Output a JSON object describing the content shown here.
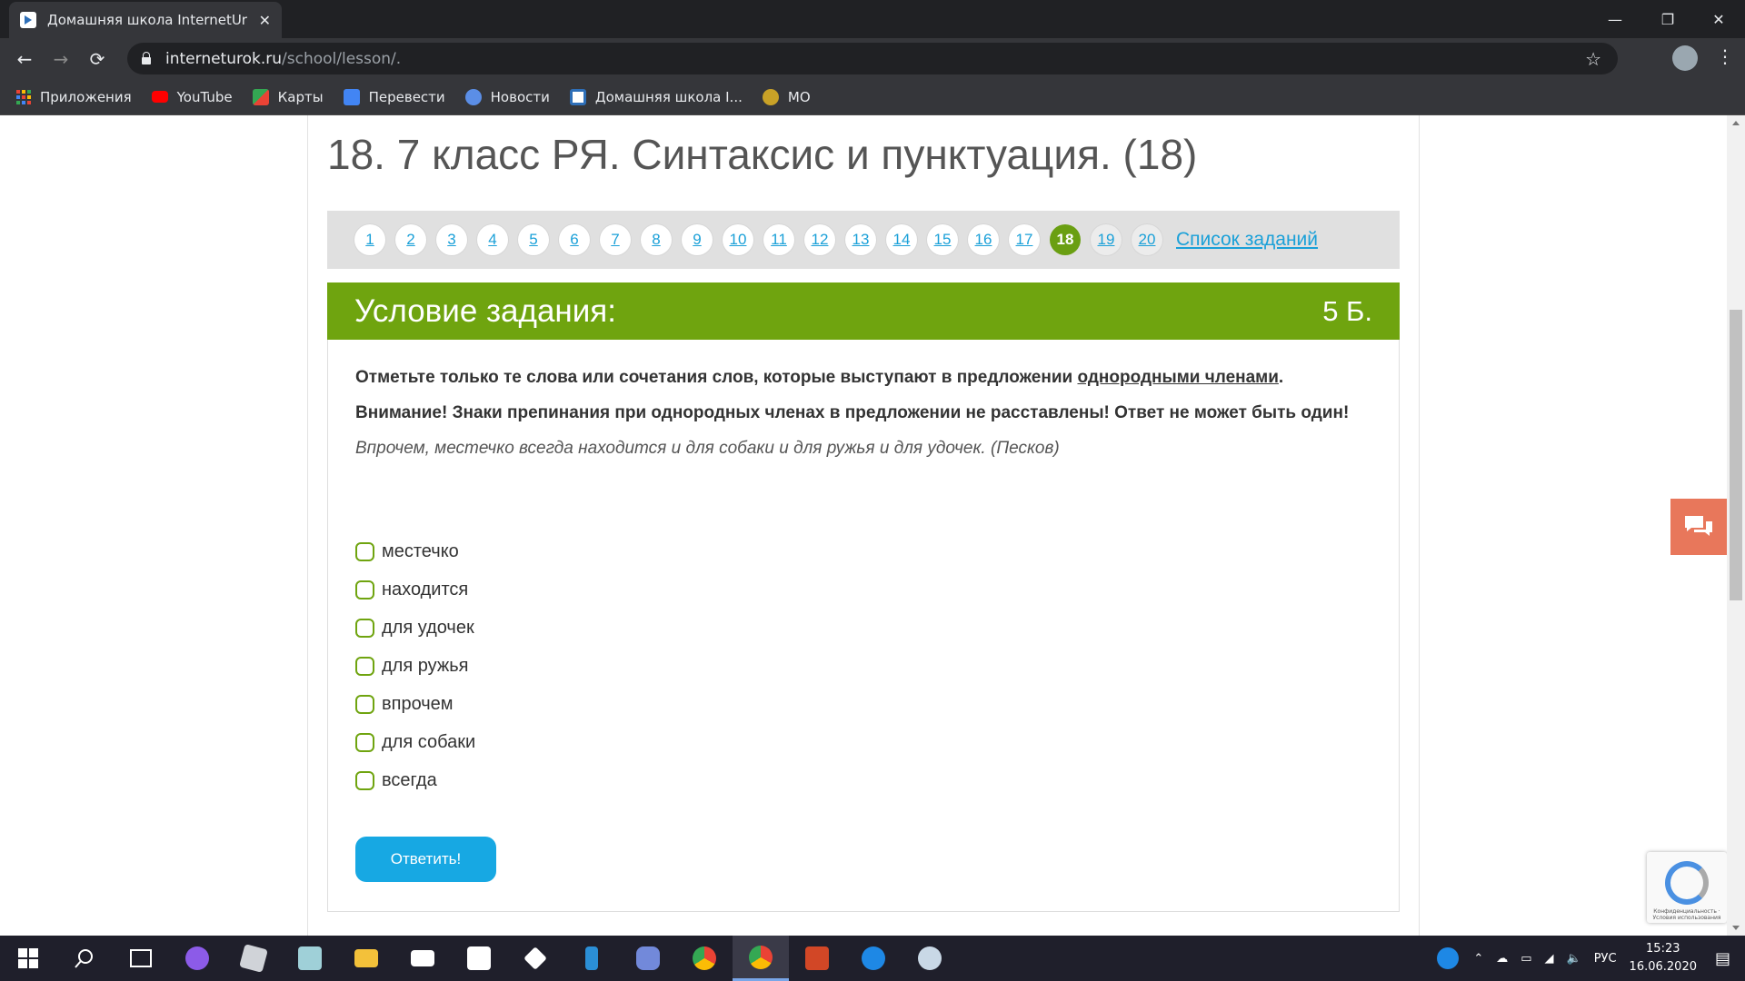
{
  "browser": {
    "tab_title": "Домашняя школа InternetUrok.r",
    "tab_close": "✕",
    "url_host": "interneturok.ru",
    "url_path": "/school/lesson/.",
    "controls": {
      "minimize": "—",
      "maximize": "❐",
      "close": "✕"
    },
    "nav": {
      "back": "←",
      "forward": "→",
      "reload": "⟳"
    },
    "star": "☆",
    "menu": "⋮"
  },
  "bookmarks": [
    {
      "label": "Приложения",
      "icon": "apps-icon"
    },
    {
      "label": "YouTube",
      "icon": "youtube-icon",
      "color": "#ff0000"
    },
    {
      "label": "Карты",
      "icon": "maps-icon",
      "color": "#34a853"
    },
    {
      "label": "Перевести",
      "icon": "translate-icon",
      "color": "#4285f4"
    },
    {
      "label": "Новости",
      "icon": "news-icon",
      "color": "#5b8ee6"
    },
    {
      "label": "Домашняя школа I...",
      "icon": "interneturok-icon",
      "color": "#2e6fb8"
    },
    {
      "label": "МО",
      "icon": "mo-icon",
      "color": "#c9a227"
    }
  ],
  "lesson": {
    "title": "18. 7 класс РЯ. Синтаксис и пунктуация. (18)"
  },
  "pager": {
    "pages": [
      "1",
      "2",
      "3",
      "4",
      "5",
      "6",
      "7",
      "8",
      "9",
      "10",
      "11",
      "12",
      "13",
      "14",
      "15",
      "16",
      "17",
      "18",
      "19",
      "20"
    ],
    "active": "18",
    "list_link": "Список заданий"
  },
  "task": {
    "heading": "Условие задания:",
    "points": "5 Б.",
    "instruction_before": "Отметьте только те слова или сочетания слов, которые выступают в предложении ",
    "instruction_underlined": "однородными членами",
    "instruction_after": ".",
    "warning": "Внимание! Знаки препинания при однородных членах в предложении не расставлены! Ответ не может быть один!",
    "sentence": "Впрочем, местечко всегда находится и для собаки и для ружья и для удочек. (Песков)",
    "options": [
      "местечко",
      "находится",
      "для удочек",
      "для ружья",
      "впрочем",
      "для собаки",
      "всегда"
    ],
    "answer_button": "Ответить!"
  },
  "recaptcha": {
    "caption": "Конфиденциальность · Условия использования"
  },
  "taskbar": {
    "lang": "РУС",
    "time": "15:23",
    "date": "16.06.2020"
  },
  "colors": {
    "accent_green": "#6fa40f",
    "link_blue": "#1aa0d8",
    "button_blue": "#17a8e3",
    "chat_orange": "#e8775b"
  }
}
